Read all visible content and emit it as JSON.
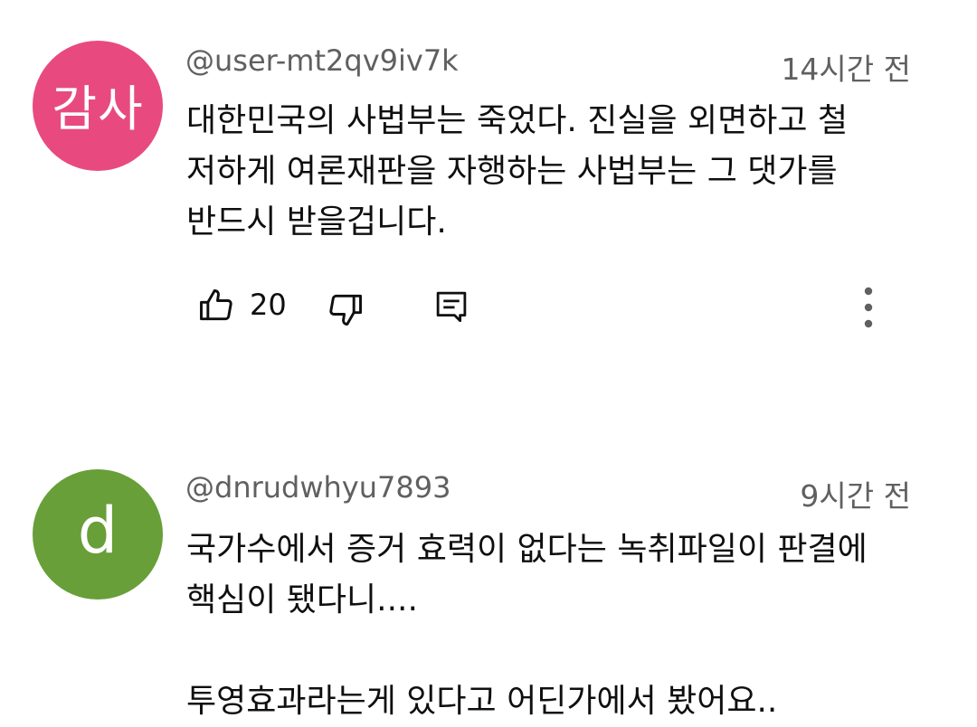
{
  "comments": [
    {
      "avatar_text": "감사",
      "avatar_color": "#e84a7f",
      "username": "@user-mt2qv9iv7k",
      "timestamp": "14시간 전",
      "lines": [
        "대한민국의 사법부는 죽었다. 진실을 외면하고 철",
        "저하게 여론재판을 자행하는 사법부는 그 댓가를",
        "반드시 받을겁니다."
      ],
      "like_count": "20",
      "icons": [
        "thumbs-up-icon",
        "thumbs-down-icon",
        "reply-icon",
        "more-vert-icon"
      ]
    },
    {
      "avatar_text": "d",
      "avatar_color": "#689f38",
      "username": "@dnrudwhyu7893",
      "timestamp": "9시간 전",
      "lines": [
        "국가수에서 증거 효력이 없다는 녹취파일이 판결에",
        "핵심이 됐다니....",
        "",
        "투영효과라는게 있다고 어딘가에서 봤어요.."
      ]
    }
  ]
}
